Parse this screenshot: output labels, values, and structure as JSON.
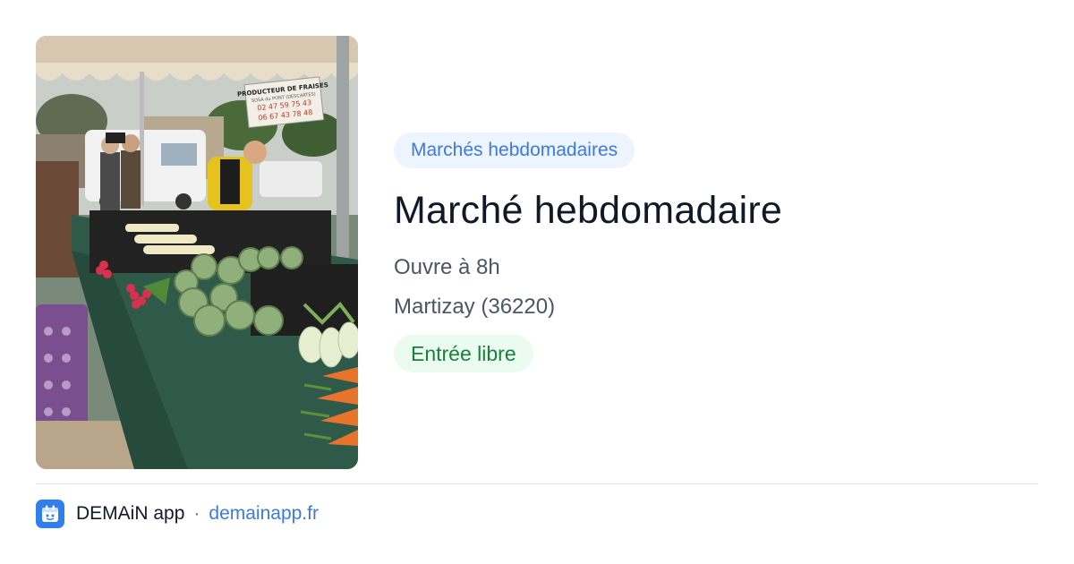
{
  "event": {
    "category": "Marchés hebdomadaires",
    "title": "Marché hebdomadaire",
    "hours": "Ouvre à 8h",
    "location": "Martizay (36220)",
    "price": "Entrée libre"
  },
  "photo": {
    "sign_lines": [
      "PRODUCTEUR DE FRAISES",
      "SOSA du PONT (DESCARTES)",
      "02 47 59 75 43",
      "06 67 43 78 48"
    ]
  },
  "footer": {
    "app_name": "DEMAiN app",
    "separator": "·",
    "url": "demainapp.fr",
    "logo_icon": "demain-logo-icon"
  },
  "colors": {
    "category_text": "#3b7ae0",
    "category_bg": "#eef4fd",
    "price_text": "#18803d",
    "price_bg": "#ecfbf0",
    "brand": "#2f80ed"
  }
}
